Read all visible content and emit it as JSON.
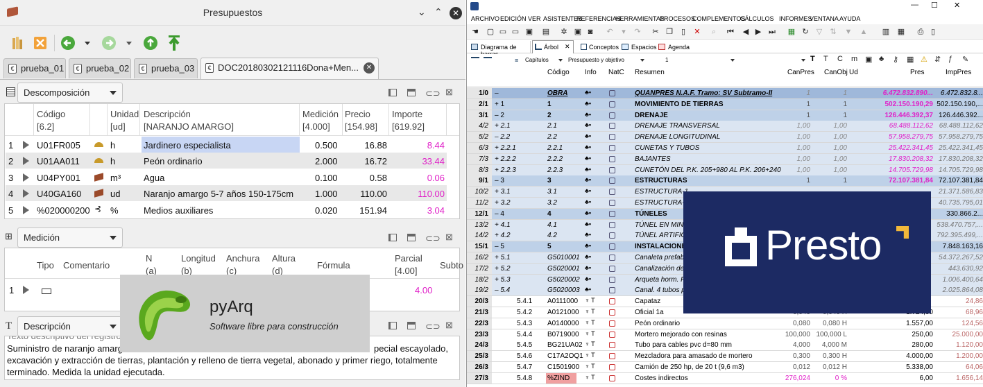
{
  "left": {
    "title": "Presupuestos",
    "tabs": [
      "prueba_01",
      "prueba_02",
      "prueba_03",
      "DOC20180302121116Dona+Men..."
    ],
    "decomp": {
      "combo": "Descomposición",
      "headers": [
        [
          "Código",
          "[6.2]"
        ],
        [
          "Unidad",
          "[ud]"
        ],
        [
          "Descripción",
          "[NARANJO AMARGO]"
        ],
        [
          "Medición",
          "[4.000]"
        ],
        [
          "Precio",
          "[154.98]"
        ],
        [
          "Importe",
          "[619.92]"
        ]
      ],
      "rows": [
        {
          "n": "1",
          "code": "U01FR005",
          "unit": "h",
          "desc": "Jardinero especialista",
          "med": "0.500",
          "price": "16.88",
          "imp": "8.44"
        },
        {
          "n": "2",
          "code": "U01AA011",
          "unit": "h",
          "desc": "Peón ordinario",
          "med": "2.000",
          "price": "16.72",
          "imp": "33.44"
        },
        {
          "n": "3",
          "code": "U04PY001",
          "unit": "m³",
          "desc": "Agua",
          "med": "0.100",
          "price": "0.58",
          "imp": "0.06"
        },
        {
          "n": "4",
          "code": "U40GA160",
          "unit": "ud",
          "desc": "Naranjo amargo 5-7 años 150-175cm",
          "med": "1.000",
          "price": "110.00",
          "imp": "110.00"
        },
        {
          "n": "5",
          "code": "%020000200",
          "unit": "%",
          "desc": "Medios auxiliares",
          "med": "0.020",
          "price": "151.94",
          "imp": "3.04"
        }
      ]
    },
    "medicion": {
      "combo": "Medición",
      "headers": [
        "Tipo",
        "Comentario",
        "N",
        "(a)",
        "Longitud",
        "(b)",
        "Anchura",
        "(c)",
        "Altura",
        "(d)",
        "Fórmula",
        "Parcial",
        "[4.00]",
        "Subto"
      ],
      "row": {
        "n": "1",
        "parcial": "4.00"
      }
    },
    "descripcion": {
      "combo": "Descripción",
      "cut_top": "Texto descriptivo del registro",
      "text_line1_a": "Suministro de naranjo amarg",
      "text_line1_b": "pecial escayolado,",
      "text_line2": "excavación y extracción de tierras, plantación y relleno de tierra vegetal, abonado y primer riego, totalmente",
      "text_line3": "terminado. Medida la unidad ejecutada."
    },
    "logo": {
      "name": "pyArq",
      "tagline": "Software libre para construcción"
    }
  },
  "right": {
    "menu": [
      "ARCHIVO",
      "EDICIÓN",
      "VER",
      "ASISTENTES",
      "REFERENCIAS",
      "HERRAMIENTAS",
      "PROCESOS",
      "COMPLEMENTOS",
      "CÁLCULOS",
      "INFORMES",
      "VENTANA",
      "AYUDA"
    ],
    "tabs": [
      "Diagrama de barras",
      "Árbol",
      "Conceptos",
      "Espacios",
      "Agenda"
    ],
    "filters": {
      "capitulos": "Capítulos",
      "presupuesto": "Presupuesto y objetivo",
      "level": "1"
    },
    "headers": [
      "Código",
      "Info",
      "NatC",
      "Resumen",
      "CanPres",
      "CanObj",
      "Ud",
      "Pres",
      "ImpPres"
    ],
    "rows": [
      {
        "id": "1/0",
        "ind": "–",
        "code": "OBRA",
        "res": "QUANPRES N.A.F. Tramo: SV Subtramo-II",
        "cp": "1",
        "co": "1",
        "ud": "",
        "pres": "6.472.832.890...",
        "imp": "6.472.832.8...",
        "style": "obra"
      },
      {
        "id": "2/1",
        "ind": "+ 1",
        "code": "1",
        "res": "MOVIMIENTO DE TIERRAS",
        "cp": "1",
        "co": "1",
        "ud": "",
        "pres": "502.150.190,29",
        "imp": "502.150.190,...",
        "style": "cap"
      },
      {
        "id": "3/1",
        "ind": "– 2",
        "code": "2",
        "res": "DRENAJE",
        "cp": "1",
        "co": "1",
        "ud": "",
        "pres": "126.446.392,37",
        "imp": "126.446.392...",
        "style": "cap"
      },
      {
        "id": "4/2",
        "ind": "+ 2.1",
        "code": "2.1",
        "res": "DRENAJE TRANSVERSAL",
        "cp": "1,00",
        "co": "1,00",
        "ud": "",
        "pres": "68.488.112,62",
        "imp": "68.488.112,62",
        "style": "sub"
      },
      {
        "id": "5/2",
        "ind": "– 2.2",
        "code": "2.2",
        "res": "DRENAJE LONGITUDINAL",
        "cp": "1,00",
        "co": "1,00",
        "ud": "",
        "pres": "57.958.279,75",
        "imp": "57.958.279,75",
        "style": "sub"
      },
      {
        "id": "6/3",
        "ind": "+ 2.2.1",
        "code": "2.2.1",
        "res": "CUNETAS Y TUBOS",
        "cp": "1,00",
        "co": "1,00",
        "ud": "",
        "pres": "25.422.341,45",
        "imp": "25.422.341,45",
        "style": "sub"
      },
      {
        "id": "7/3",
        "ind": "+ 2.2.2",
        "code": "2.2.2",
        "res": "BAJANTES",
        "cp": "1,00",
        "co": "1,00",
        "ud": "",
        "pres": "17.830.208,32",
        "imp": "17.830.208,32",
        "style": "sub"
      },
      {
        "id": "8/3",
        "ind": "+ 2.2.3",
        "code": "2.2.3",
        "res": "CUNETÓN DEL P.K. 205+980 AL P.K. 206+240",
        "cp": "1,00",
        "co": "1,00",
        "ud": "",
        "pres": "14.705.729,98",
        "imp": "14.705.729,98",
        "style": "sub"
      },
      {
        "id": "9/1",
        "ind": "– 3",
        "code": "3",
        "res": "ESTRUCTURAS",
        "cp": "1",
        "co": "1",
        "ud": "",
        "pres": "72.107.381,84",
        "imp": "72.107.381,84",
        "style": "cap"
      },
      {
        "id": "10/2",
        "ind": "+ 3.1",
        "code": "3.1",
        "res": "ESTRUCTURA-1",
        "cp": "",
        "co": "",
        "ud": "",
        "pres": "",
        "imp": "21.371.586,83",
        "style": "sub"
      },
      {
        "id": "11/2",
        "ind": "+ 3.2",
        "code": "3.2",
        "res": "ESTRUCTURA-2",
        "cp": "",
        "co": "",
        "ud": "",
        "pres": "",
        "imp": "40.735.795,01",
        "style": "sub"
      },
      {
        "id": "12/1",
        "ind": "– 4",
        "code": "4",
        "res": "TÚNELES",
        "cp": "",
        "co": "",
        "ud": "",
        "pres": "",
        "imp": "330.866.2...",
        "style": "cap"
      },
      {
        "id": "13/2",
        "ind": "+ 4.1",
        "code": "4.1",
        "res": "TÚNEL EN MINA",
        "cp": "",
        "co": "",
        "ud": "",
        "pres": "",
        "imp": "538.470.757,...",
        "style": "sub"
      },
      {
        "id": "14/2",
        "ind": "+ 4.2",
        "code": "4.2",
        "res": "TÚNEL ARTIFICIAL",
        "cp": "",
        "co": "",
        "ud": "",
        "pres": "",
        "imp": "792.395.499,...",
        "style": "sub"
      },
      {
        "id": "15/1",
        "ind": "– 5",
        "code": "5",
        "res": "INSTALACIONES",
        "cp": "",
        "co": "",
        "ud": "",
        "pres": "",
        "imp": "7.848.163,16",
        "style": "cap"
      },
      {
        "id": "16/2",
        "ind": "+ 5.1",
        "code": "G5010001",
        "res": "Canaleta prefab",
        "cp": "",
        "co": "",
        "ud": "",
        "pres": "",
        "imp": "54.372.267,52",
        "style": "sub"
      },
      {
        "id": "17/2",
        "ind": "+ 5.2",
        "code": "G5020001",
        "res": "Canalización de",
        "cp": "",
        "co": "",
        "ud": "",
        "pres": "",
        "imp": "443.630,92",
        "style": "sub"
      },
      {
        "id": "18/2",
        "ind": "+ 5.3",
        "code": "G5020002",
        "res": "Arqueta horm. P",
        "cp": "",
        "co": "",
        "ud": "",
        "pres": "",
        "imp": "1.006.400,64",
        "style": "sub"
      },
      {
        "id": "19/2",
        "ind": "– 5.4",
        "code": "G5020003",
        "res": "Canal. 4 tubos p",
        "cp": "",
        "co": "",
        "ud": "",
        "pres": "",
        "imp": "2.025.864,08",
        "style": "sub"
      },
      {
        "id": "20/3",
        "ind": "5.4.1",
        "code": "A0111000",
        "res": "Capataz",
        "cp": "",
        "co": "",
        "ud": "",
        "pres": "",
        "imp": "24,86",
        "style": "leaf"
      },
      {
        "id": "21/3",
        "ind": "5.4.2",
        "code": "A0121000",
        "res": "Oficial 1a",
        "cp": "0,040",
        "co": "0,040 H",
        "ud": "",
        "pres": "1.724,00",
        "imp": "68,96",
        "style": "leaf"
      },
      {
        "id": "22/3",
        "ind": "5.4.3",
        "code": "A0140000",
        "res": "Peón ordinario",
        "cp": "0,080",
        "co": "0,080 H",
        "ud": "",
        "pres": "1.557,00",
        "imp": "124,56",
        "style": "leaf"
      },
      {
        "id": "23/3",
        "ind": "5.4.4",
        "code": "B0719000",
        "res": "Mortero mejorado con resinas",
        "cp": "100,000",
        "co": "100,000 L",
        "ud": "",
        "pres": "250,00",
        "imp": "25.000,00",
        "style": "leaf"
      },
      {
        "id": "24/3",
        "ind": "5.4.5",
        "code": "BG21UA02",
        "res": "Tubo para cables pvc d=80 mm",
        "cp": "4,000",
        "co": "4,000 M",
        "ud": "",
        "pres": "280,00",
        "imp": "1.120,00",
        "style": "leaf"
      },
      {
        "id": "25/3",
        "ind": "5.4.6",
        "code": "C17A2OQ1",
        "res": "Mezcladora para amasado de mortero",
        "cp": "0,300",
        "co": "0,300 H",
        "ud": "",
        "pres": "4.000,00",
        "imp": "1.200,00",
        "style": "leaf"
      },
      {
        "id": "26/3",
        "ind": "5.4.7",
        "code": "C1501900",
        "res": "Camión de 250 hp, de 20 t (9,6 m3)",
        "cp": "0,012",
        "co": "0,012 H",
        "ud": "",
        "pres": "5.338,00",
        "imp": "64,06",
        "style": "leaf"
      },
      {
        "id": "27/3",
        "ind": "5.4.8",
        "code": "%ZIND",
        "res": "Costes indirectos",
        "cp": "276,024",
        "co": "0 %",
        "ud": "",
        "pres": "6,00",
        "imp": "1.656,14",
        "style": "last"
      }
    ],
    "logo": "Presto"
  }
}
